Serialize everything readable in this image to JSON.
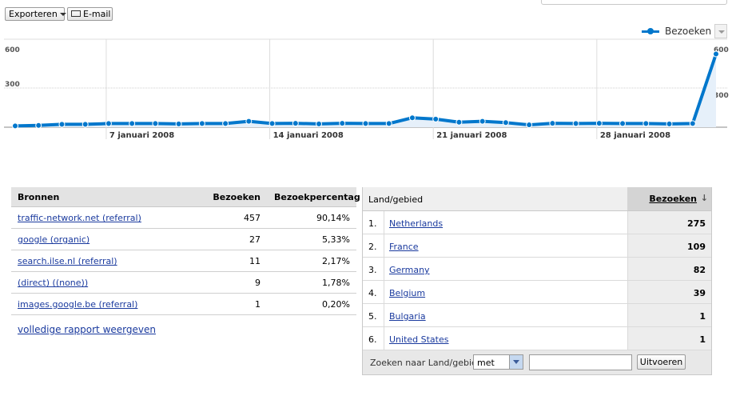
{
  "toolbar": {
    "export_label": "Exporteren",
    "email_label": "E-mail"
  },
  "legend": {
    "series_label": "Bezoeken",
    "color": "#0077cc"
  },
  "chart_data": {
    "type": "line",
    "series": [
      {
        "name": "Bezoeken",
        "values": [
          10,
          14,
          22,
          22,
          28,
          28,
          28,
          25,
          28,
          28,
          45,
          28,
          30,
          25,
          30,
          28,
          28,
          72,
          62,
          38,
          45,
          35,
          18,
          30,
          28,
          30,
          28,
          28,
          25,
          28,
          560
        ]
      }
    ],
    "y_ticks": [
      "600",
      "300"
    ],
    "ylim": [
      0,
      600
    ],
    "x_ticks": [
      {
        "index": 4,
        "label": "7 januari 2008"
      },
      {
        "index": 11,
        "label": "14 januari 2008"
      },
      {
        "index": 18,
        "label": "21 januari 2008"
      },
      {
        "index": 25,
        "label": "28 januari 2008"
      }
    ],
    "right_label": "600",
    "right_label_low": "300",
    "grid": true
  },
  "sources": {
    "headers": {
      "source": "Bronnen",
      "visits": "Bezoeken",
      "percent": "Bezoekpercentag"
    },
    "rows": [
      {
        "source": "traffic-network.net (referral)",
        "visits": "457",
        "percent": "90,14%"
      },
      {
        "source": "google (organic)",
        "visits": "27",
        "percent": "5,33%"
      },
      {
        "source": "search.ilse.nl (referral)",
        "visits": "11",
        "percent": "2,17%"
      },
      {
        "source": "(direct) ((none))",
        "visits": "9",
        "percent": "1,78%"
      },
      {
        "source": "images.google.be (referral)",
        "visits": "1",
        "percent": "0,20%"
      }
    ],
    "full_report_link": "volledige rapport weergeven"
  },
  "countries": {
    "headers": {
      "country": "Land/gebied",
      "visits": "Bezoeken"
    },
    "rows": [
      {
        "num": "1.",
        "name": "Netherlands",
        "visits": "275"
      },
      {
        "num": "2.",
        "name": "France",
        "visits": "109"
      },
      {
        "num": "3.",
        "name": "Germany",
        "visits": "82"
      },
      {
        "num": "4.",
        "name": "Belgium",
        "visits": "39"
      },
      {
        "num": "5.",
        "name": "Bulgaria",
        "visits": "1"
      },
      {
        "num": "6.",
        "name": "United States",
        "visits": "1"
      }
    ],
    "search": {
      "label": "Zoeken naar Land/gebied",
      "match_select": "met",
      "input_value": "",
      "submit_label": "Uitvoeren"
    }
  }
}
